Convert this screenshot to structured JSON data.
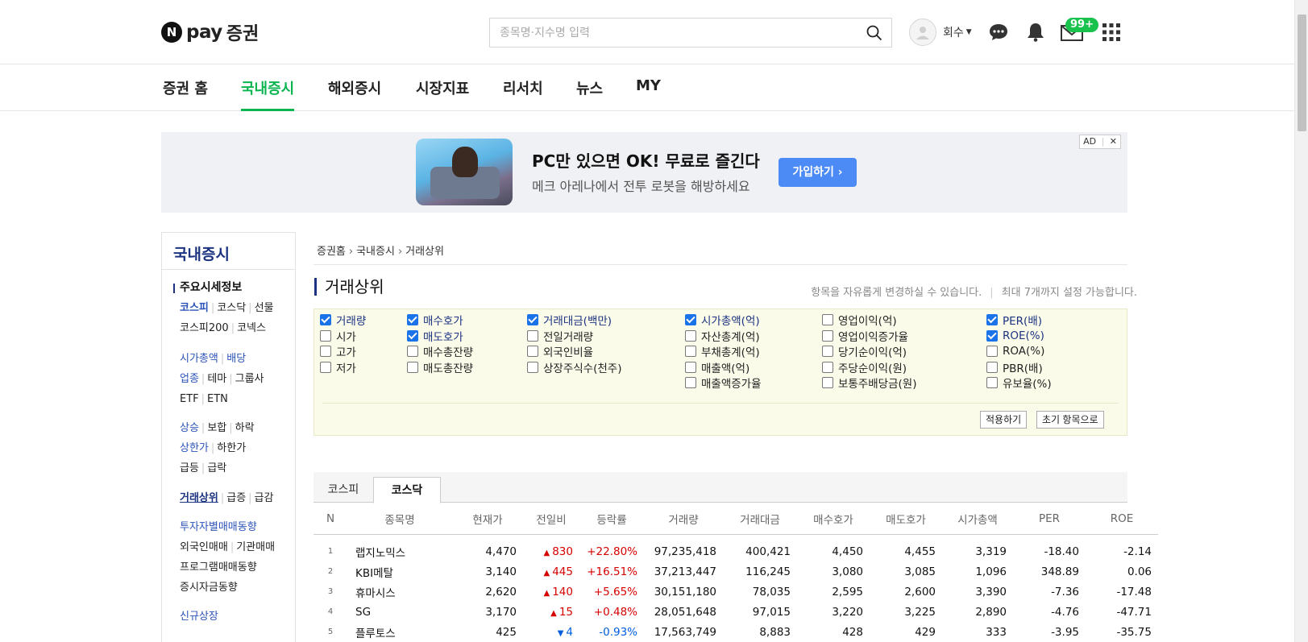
{
  "header": {
    "logo_n": "N",
    "logo_pay": "pay",
    "logo_jg": "증권",
    "search_placeholder": "종목명·지수명 입력",
    "user_name": "회수",
    "mail_badge": "99+"
  },
  "nav": [
    "증권 홈",
    "국내증시",
    "해외증시",
    "시장지표",
    "리서치",
    "뉴스",
    "MY"
  ],
  "nav_active": "국내증시",
  "ad": {
    "title": "PC만 있으면 OK! 무료로 즐긴다",
    "subtitle": "메크 아레나에서 전투 로봇을 해방하세요",
    "button": "가입하기 ›",
    "tag": "AD",
    "close": "✕"
  },
  "sidebar": {
    "title": "국내증시",
    "section": "주요시세정보",
    "rows": {
      "r1": [
        "코스피",
        "코스닥",
        "선물"
      ],
      "r2": [
        "코스피200",
        "코넥스"
      ],
      "r3": [
        "시가총액",
        "배당"
      ],
      "r4": [
        "업종",
        "테마",
        "그룹사"
      ],
      "r5": [
        "ETF",
        "ETN"
      ],
      "r6": [
        "상승",
        "보합",
        "하락"
      ],
      "r7": [
        "상한가",
        "하한가"
      ],
      "r8": [
        "급등",
        "급락"
      ],
      "r9": [
        "거래상위",
        "급증",
        "급감"
      ],
      "r10": [
        "투자자별매매동향"
      ],
      "r11": [
        "외국인매매",
        "기관매매"
      ],
      "r12": [
        "프로그램매매동향"
      ],
      "r13": [
        "증시자금동향"
      ],
      "r14": [
        "신규상장"
      ]
    }
  },
  "breadcrumb": [
    "증권홈",
    "국내증시",
    "거래상위"
  ],
  "page_title": "거래상위",
  "page_note_1": "항목을 자유롭게 변경하실 수 있습니다.",
  "page_note_2": "최대 7개까지 설정 가능합니다.",
  "options": [
    {
      "label": "거래량",
      "checked": true
    },
    {
      "label": "시가",
      "checked": false
    },
    {
      "label": "고가",
      "checked": false
    },
    {
      "label": "저가",
      "checked": false
    },
    {
      "label": "매수호가",
      "checked": true
    },
    {
      "label": "매도호가",
      "checked": true
    },
    {
      "label": "매수총잔량",
      "checked": false
    },
    {
      "label": "매도총잔량",
      "checked": false
    },
    {
      "label": "거래대금(백만)",
      "checked": true
    },
    {
      "label": "전일거래량",
      "checked": false
    },
    {
      "label": "외국인비율",
      "checked": false
    },
    {
      "label": "상장주식수(천주)",
      "checked": false
    },
    {
      "label": "시가총액(억)",
      "checked": true
    },
    {
      "label": "자산총계(억)",
      "checked": false
    },
    {
      "label": "부채총계(억)",
      "checked": false
    },
    {
      "label": "매출액(억)",
      "checked": false
    },
    {
      "label": "매출액증가율",
      "checked": false
    },
    {
      "label": "영업이익(억)",
      "checked": false
    },
    {
      "label": "영업이익증가율",
      "checked": false
    },
    {
      "label": "당기순이익(억)",
      "checked": false
    },
    {
      "label": "주당순이익(원)",
      "checked": false
    },
    {
      "label": "보통주배당금(원)",
      "checked": false
    },
    {
      "label": "PER(배)",
      "checked": true
    },
    {
      "label": "ROE(%)",
      "checked": true
    },
    {
      "label": "ROA(%)",
      "checked": false
    },
    {
      "label": "PBR(배)",
      "checked": false
    },
    {
      "label": "유보율(%)",
      "checked": false
    }
  ],
  "buttons": {
    "apply": "적용하기",
    "reset": "초기 항목으로"
  },
  "tabs": [
    "코스피",
    "코스닥"
  ],
  "tab_active": "코스닥",
  "table": {
    "headers": [
      "N",
      "종목명",
      "현재가",
      "전일비",
      "등락률",
      "거래량",
      "거래대금",
      "매수호가",
      "매도호가",
      "시가총액",
      "PER",
      "ROE"
    ],
    "rows": [
      [
        "1",
        "랩지노믹스",
        "4,470",
        "830",
        "+22.80%",
        "97,235,418",
        "400,421",
        "4,450",
        "4,455",
        "3,319",
        "-18.40",
        "-2.14"
      ],
      [
        "2",
        "KBI메탈",
        "3,140",
        "445",
        "+16.51%",
        "37,213,447",
        "116,245",
        "3,080",
        "3,085",
        "1,096",
        "348.89",
        "0.06"
      ],
      [
        "3",
        "휴마시스",
        "2,620",
        "140",
        "+5.65%",
        "30,151,180",
        "78,035",
        "2,595",
        "2,600",
        "3,390",
        "-7.36",
        "-17.48"
      ],
      [
        "4",
        "SG",
        "3,170",
        "15",
        "+0.48%",
        "28,051,648",
        "97,015",
        "3,220",
        "3,225",
        "2,890",
        "-4.76",
        "-47.71"
      ],
      [
        "5",
        "플루토스",
        "425",
        "4",
        "-0.93%",
        "17,563,749",
        "8,883",
        "428",
        "429",
        "333",
        "-3.95",
        "-35.75"
      ]
    ],
    "directions": [
      "up",
      "up",
      "up",
      "up",
      "down"
    ]
  }
}
